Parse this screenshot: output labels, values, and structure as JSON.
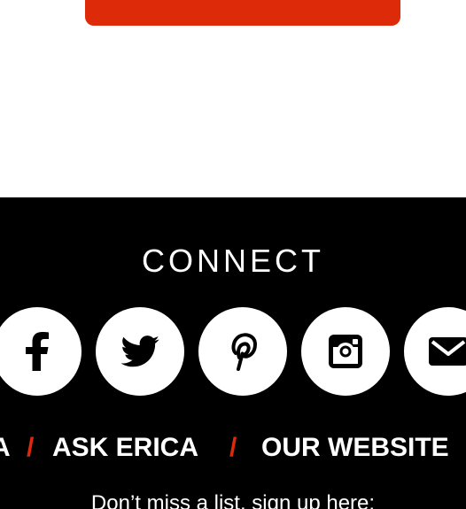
{
  "top_button": {
    "color": "#dd2a08"
  },
  "footer": {
    "background": "#000000",
    "heading": "CONNECT",
    "social": [
      {
        "name": "facebook",
        "icon": "facebook-icon"
      },
      {
        "name": "twitter",
        "icon": "twitter-icon"
      },
      {
        "name": "pinterest",
        "icon": "pinterest-icon"
      },
      {
        "name": "instagram",
        "icon": "instagram-icon"
      },
      {
        "name": "email",
        "icon": "email-icon"
      }
    ],
    "nav": {
      "partial_left": "A",
      "separator": "/",
      "ask_erica": "ASK ERICA",
      "our_website": "OUR WEBSITE"
    },
    "signup_text": "Don’t miss a list, sign up here:",
    "accent_color": "#dd2a08"
  }
}
